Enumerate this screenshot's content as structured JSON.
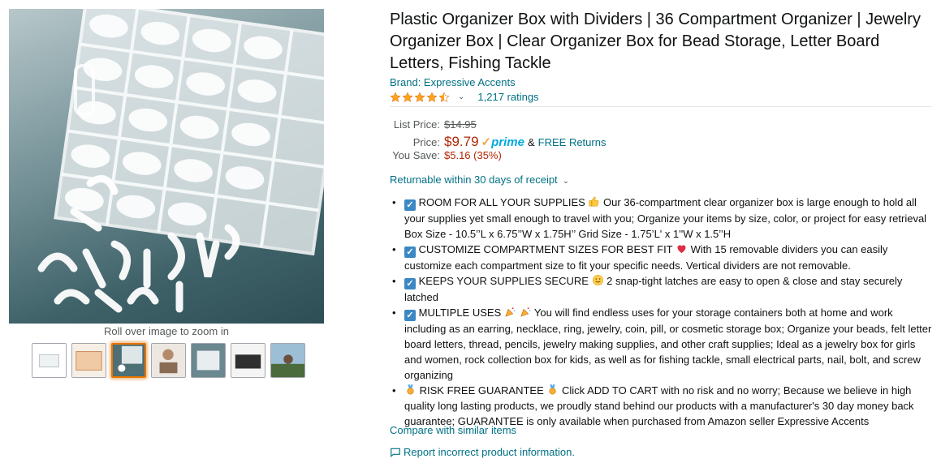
{
  "gallery": {
    "zoom_hint": "Roll over image to zoom in",
    "thumbnails": [
      "thumb-1",
      "thumb-2",
      "thumb-3",
      "thumb-4",
      "thumb-5",
      "thumb-6",
      "thumb-7"
    ],
    "active_thumbnail": 2
  },
  "product": {
    "title": "Plastic Organizer Box with Dividers | 36 Compartment Organizer | Jewelry Organizer Box | Clear Organizer Box for Bead Storage, Letter Board Letters, Fishing Tackle",
    "brand": "Brand: Expressive Accents",
    "rating": 4.5,
    "ratings_count": "1,217 ratings"
  },
  "pricing": {
    "list_price_label": "List Price:",
    "list_price": "$14.95",
    "price_label": "Price:",
    "price": "$9.79",
    "prime_label": "prime",
    "amp": "&",
    "free_returns": "FREE Returns",
    "save_label": "You Save:",
    "savings": "$5.16 (35%)"
  },
  "returnable": "Returnable within 30 days of receipt",
  "bullets": [
    {
      "prefix_icon": "check-box-icon",
      "text_a": "ROOM FOR ALL YOUR SUPPLIES",
      "mid_icon": "thumbs-up-icon",
      "text_b": "Our 36-compartment clear organizer box is large enough to hold all your supplies yet small enough to travel with you; Organize your items by size, color, or project for easy retrieval Box Size - 10.5’’L x 6.75’’W x 1.75H’’ Grid Size - 1.75’L' x 1''W x 1.5’’H"
    },
    {
      "prefix_icon": "check-box-icon",
      "text_a": "CUSTOMIZE COMPARTMENT SIZES FOR BEST FIT",
      "mid_icon": "heart-icon",
      "text_b": "With 15 removable dividers you can easily customize each compartment size to fit your specific needs. Vertical dividers are not removable."
    },
    {
      "prefix_icon": "check-box-icon",
      "text_a": "KEEPS YOUR SUPPLIES SECURE",
      "mid_icon": "smile-icon",
      "text_b": "2 snap-tight latches are easy to open & close and stay securely latched"
    },
    {
      "prefix_icon": "check-box-icon",
      "text_a": "MULTIPLE USES",
      "mid_icon": "party-popper-icon",
      "text_b": "You will find endless uses for your storage containers both at home and work including as an earring, necklace, ring, jewelry, coin, pill, or cosmetic storage box; Organize your beads, felt letter board letters, thread, pencils, jewelry making supplies, and other craft supplies; Ideal as a jewelry box for girls and women, rock collection box for kids, as well as for fishing tackle, small electrical parts, nail, bolt, and screw organizing"
    },
    {
      "prefix_icon": "medal-icon",
      "text_a": "RISK FREE GUARANTEE",
      "mid_icon": "medal-icon",
      "text_b": "Click ADD TO CART with no risk and no worry; Because we believe in high quality long lasting products, we proudly stand behind our products with a manufacturer's 30 day money back guarantee; GUARANTEE is only available when purchased from Amazon seller Expressive Accents"
    }
  ],
  "links": {
    "compare": "Compare with similar items",
    "report": "Report incorrect product information."
  },
  "colors": {
    "link": "#007185",
    "price": "#b12704",
    "star": "#ffa41c",
    "prime": "#00a8e1",
    "active_thumb": "#e77600"
  }
}
